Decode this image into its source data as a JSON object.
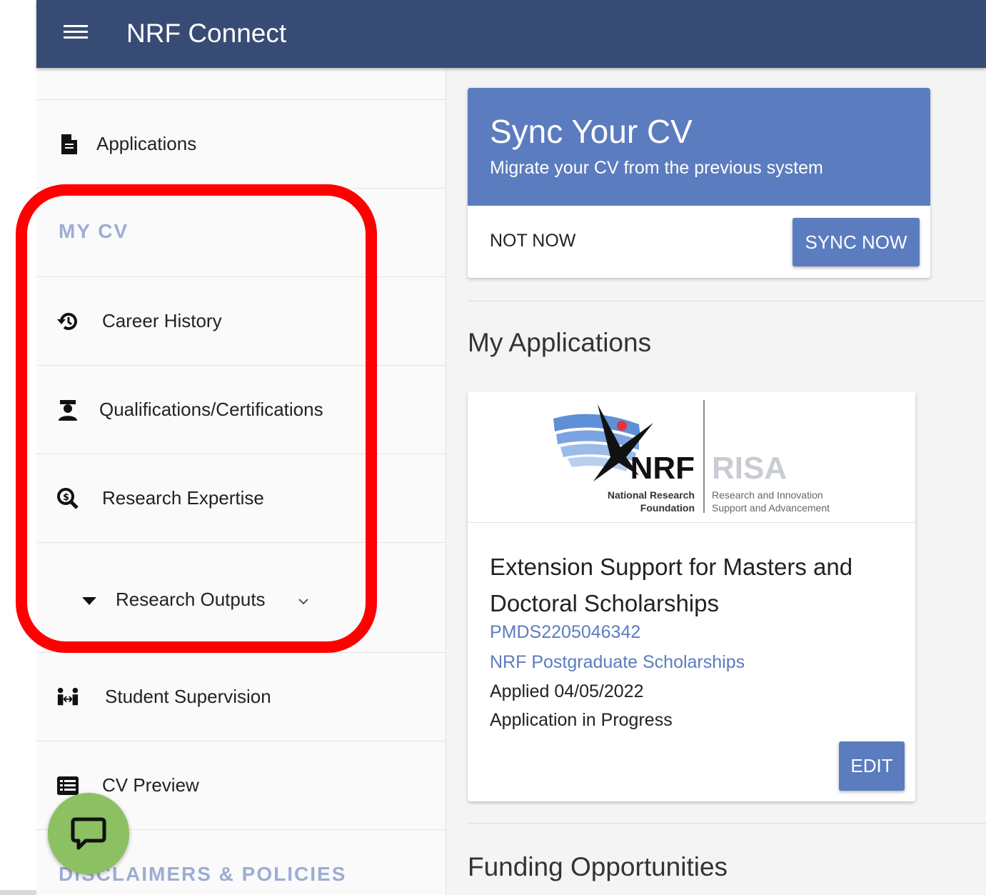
{
  "header": {
    "title": "NRF Connect",
    "menu_icon": "hamburger-menu-icon"
  },
  "sidebar": {
    "applications_label": "Applications",
    "my_cv_heading": "MY CV",
    "items": [
      {
        "label": "Career History",
        "icon": "history-icon"
      },
      {
        "label": "Qualifications/Certifications",
        "icon": "graduate-icon"
      },
      {
        "label": "Research Expertise",
        "icon": "search-dollar-icon"
      },
      {
        "label": "Research Outputs",
        "icon": "caret-down-icon"
      },
      {
        "label": "Student Supervision",
        "icon": "people-arrows-icon"
      },
      {
        "label": "CV Preview",
        "icon": "list-icon"
      }
    ],
    "disclaimers_heading": "DISCLAIMERS & POLICIES"
  },
  "sync_card": {
    "title": "Sync Your CV",
    "subtitle": "Migrate your CV from the previous system",
    "not_now_label": "NOT NOW",
    "sync_now_label": "SYNC NOW"
  },
  "my_applications": {
    "heading": "My Applications",
    "card": {
      "logo": {
        "nrf_text": "NRF",
        "nrf_line1": "National Research",
        "nrf_line2": "Foundation",
        "risa_text": "RISA",
        "risa_line1": "Research and Innovation",
        "risa_line2": "Support and Advancement"
      },
      "title": "Extension Support for Masters and Doctoral Scholarships",
      "reference": "PMDS2205046342",
      "programme": "NRF Postgraduate Scholarships",
      "applied": "Applied 04/05/2022",
      "status": "Application in Progress",
      "edit_label": "EDIT"
    }
  },
  "funding": {
    "heading": "Funding Opportunities"
  },
  "colors": {
    "header": "#384b74",
    "accent": "#5b7cbf",
    "section_heading": "#9badd4",
    "highlight": "#ff0000",
    "chat": "#8cc063"
  }
}
